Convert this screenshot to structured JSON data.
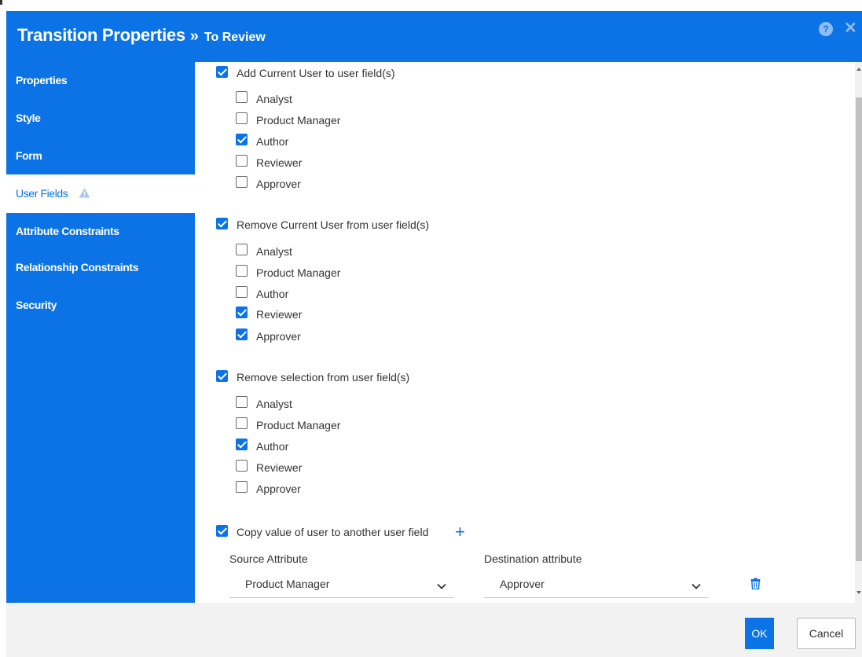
{
  "dialog": {
    "title": "Transition Properties",
    "separator": "»",
    "subtitle": "To Review",
    "help_icon": "question-circle-icon",
    "close_icon": "close-icon",
    "accent_color": "#0b73e6"
  },
  "sidebar": {
    "items": [
      {
        "label": "Properties"
      },
      {
        "label": "Style"
      },
      {
        "label": "Form"
      },
      {
        "label": "User Fields",
        "active": true,
        "icon": "warning-icon"
      },
      {
        "label": "Attribute Constraints"
      },
      {
        "label": "Relationship Constraints"
      },
      {
        "label": "Security"
      }
    ]
  },
  "sections": [
    {
      "label": "Add Current User to user field(s)",
      "checked": true,
      "options": [
        {
          "label": "Analyst",
          "checked": false
        },
        {
          "label": "Product Manager",
          "checked": false
        },
        {
          "label": "Author",
          "checked": true
        },
        {
          "label": "Reviewer",
          "checked": false
        },
        {
          "label": "Approver",
          "checked": false
        }
      ]
    },
    {
      "label": "Remove Current User from user field(s)",
      "checked": true,
      "options": [
        {
          "label": "Analyst",
          "checked": false
        },
        {
          "label": "Product Manager",
          "checked": false
        },
        {
          "label": "Author",
          "checked": false
        },
        {
          "label": "Reviewer",
          "checked": true
        },
        {
          "label": "Approver",
          "checked": true
        }
      ]
    },
    {
      "label": "Remove selection from user field(s)",
      "checked": true,
      "options": [
        {
          "label": "Analyst",
          "checked": false
        },
        {
          "label": "Product Manager",
          "checked": false
        },
        {
          "label": "Author",
          "checked": true
        },
        {
          "label": "Reviewer",
          "checked": false
        },
        {
          "label": "Approver",
          "checked": false
        }
      ]
    }
  ],
  "copy": {
    "label": "Copy value of user to another user field",
    "checked": true,
    "add_icon": "plus-icon",
    "source_label": "Source Attribute",
    "source_value": "Product Manager",
    "destination_label": "Destination attribute",
    "destination_value": "Approver",
    "delete_icon": "trash-icon"
  },
  "footer": {
    "ok_label": "OK",
    "cancel_label": "Cancel"
  }
}
